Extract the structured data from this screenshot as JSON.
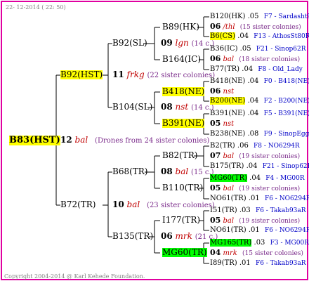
{
  "date": "22- 12-2014 ( 22: 50)",
  "footer": "Copyright 2004-2014 @ Karl Kehede Foundation.",
  "colors": {
    "border": "#e000a0",
    "highlight_yellow": "#ffff00",
    "highlight_green": "#00ff00",
    "line": "#000000",
    "code": "#0000c8",
    "year": "#c00000",
    "sisters": "#7a2a8a"
  },
  "root": {
    "name": "B83(HST)",
    "year_num": "12",
    "year_abbr": "bal",
    "note": "(Drones from 24 sister colonies)"
  },
  "gen1": [
    {
      "name": "B92(HST)",
      "year_num": "11",
      "year_abbr": "frkg",
      "note": "(22 sister colonies)"
    },
    {
      "name": "B72(TR)",
      "year_num": "10",
      "year_abbr": "bal",
      "note": "(23 sister colonies)"
    }
  ],
  "gen2": [
    {
      "name": "B92(SL)",
      "year_num": "09",
      "year_abbr": "lgn",
      "note": "(14 c.)"
    },
    {
      "name": "B104(SL)",
      "year_num": "08",
      "year_abbr": "nst",
      "note": "(14 c.)"
    },
    {
      "name": "B68(TR)",
      "year_num": "08",
      "year_abbr": "bal",
      "note": "(15 c.)"
    },
    {
      "name": "B135(TR)",
      "year_num": "06",
      "year_abbr": "mrk",
      "note": "(21 c.)"
    }
  ],
  "gen3": [
    {
      "name": "B89(HK)"
    },
    {
      "name": "B164(IC)"
    },
    {
      "name": "B418(NE)"
    },
    {
      "name": "B391(NE)"
    },
    {
      "name": "B82(TR)"
    },
    {
      "name": "B110(TR)"
    },
    {
      "name": "I177(TR)"
    },
    {
      "name": "MG60(TR)"
    }
  ],
  "gen4": [
    {
      "name": "B120(HK)",
      "num": ".05",
      "code": "F7 - Sardasht93R"
    },
    {
      "year_num": "06",
      "year_abbr": "/thl",
      "note": "(15 sister colonies)"
    },
    {
      "name": "B6(CS)",
      "num": ".04",
      "code": "F13 - AthosSt80R"
    },
    {
      "name": "B36(IC)",
      "num": ".05",
      "code": "F21 - Sinop62R"
    },
    {
      "year_num": "06",
      "year_abbr": "bal",
      "note": "(18 sister colonies)"
    },
    {
      "name": "B77(TR)",
      "num": ".04",
      "code": "F8 - Old_Lady"
    },
    {
      "name": "B418(NE)",
      "num": ".04",
      "code": "F0 - B418(NE)"
    },
    {
      "year_num": "06",
      "year_abbr": "nst",
      "note": ""
    },
    {
      "name": "B200(NE)",
      "num": ".04",
      "code": "F2 - B200(NE)"
    },
    {
      "name": "B391(NE)",
      "num": ".04",
      "code": "F5 - B391(NE)"
    },
    {
      "year_num": "05",
      "year_abbr": "nst",
      "note": ""
    },
    {
      "name": "B238(NE)",
      "num": ".08",
      "code": "F9 - SinopEgg86R"
    },
    {
      "name": "B2(TR)",
      "num": ".06",
      "code": "F8 - NO6294R"
    },
    {
      "year_num": "07",
      "year_abbr": "bal",
      "note": "(19 sister colonies)"
    },
    {
      "name": "B175(TR)",
      "num": ".04",
      "code": "F21 - Sinop62R"
    },
    {
      "name": "MG60(TR)",
      "num": ".04",
      "code": "F4 - MG00R"
    },
    {
      "year_num": "05",
      "year_abbr": "bal",
      "note": "(19 sister colonies)"
    },
    {
      "name": "NO61(TR)",
      "num": ".01",
      "code": "F6 - NO6294R"
    },
    {
      "name": "I51(TR)",
      "num": ".03",
      "code": "F6 - Takab93aR"
    },
    {
      "year_num": "05",
      "year_abbr": "bal",
      "note": "(19 sister colonies)"
    },
    {
      "name": "NO61(TR)",
      "num": ".01",
      "code": "F6 - NO6294R"
    },
    {
      "name": "MG165(TR)",
      "num": ".03",
      "code": "F3 - MG00R"
    },
    {
      "year_num": "04",
      "year_abbr": "mrk",
      "note": "(15 sister colonies)"
    },
    {
      "name": "I89(TR)",
      "num": ".01",
      "code": "F6 - Takab93aR"
    }
  ]
}
